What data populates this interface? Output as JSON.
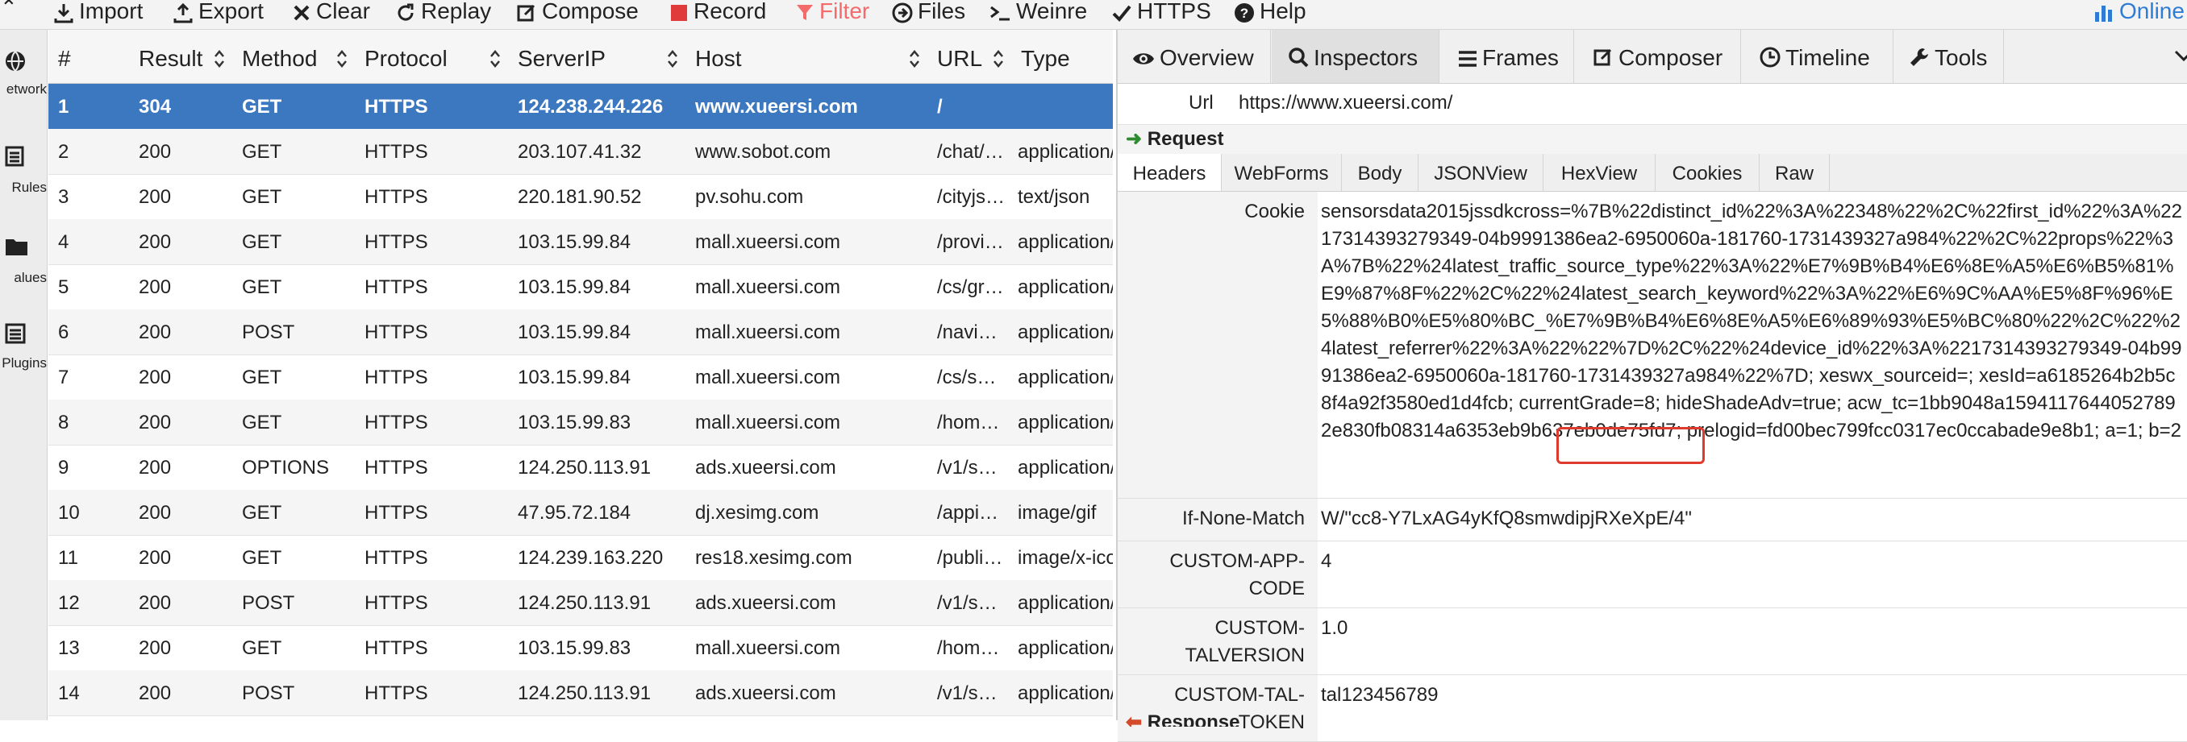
{
  "toolbar": {
    "items": [
      {
        "label": "Import",
        "icon": "import-icon"
      },
      {
        "label": "Export",
        "icon": "export-icon"
      },
      {
        "label": "Clear",
        "icon": "clear-icon"
      },
      {
        "label": "Replay",
        "icon": "replay-icon"
      },
      {
        "label": "Compose",
        "icon": "compose-icon"
      },
      {
        "label": "Record",
        "icon": "record-icon"
      },
      {
        "label": "Filter",
        "icon": "filter-icon"
      },
      {
        "label": "Files",
        "icon": "files-icon"
      },
      {
        "label": "Weinre",
        "icon": "terminal-icon"
      },
      {
        "label": "HTTPS",
        "icon": "check-icon"
      },
      {
        "label": "Help",
        "icon": "help-icon"
      }
    ],
    "online": "Online"
  },
  "sidebar": {
    "items": [
      {
        "label": "etwork",
        "icon": "network-icon"
      },
      {
        "label": "Rules",
        "icon": "rules-icon"
      },
      {
        "label": "alues",
        "icon": "values-icon"
      },
      {
        "label": "Plugins",
        "icon": "plugins-icon"
      }
    ]
  },
  "grid": {
    "columns": [
      "#",
      "Result",
      "Method",
      "Protocol",
      "ServerIP",
      "Host",
      "URL",
      "Type"
    ],
    "rows": [
      {
        "num": "1",
        "result": "304",
        "method": "GET",
        "protocol": "HTTPS",
        "ip": "124.238.244.226",
        "host": "www.xueersi.com",
        "url": "/",
        "type": ""
      },
      {
        "num": "2",
        "result": "200",
        "method": "GET",
        "protocol": "HTTPS",
        "ip": "203.107.41.32",
        "host": "www.sobot.com",
        "url": "/chat/…",
        "type": "application/"
      },
      {
        "num": "3",
        "result": "200",
        "method": "GET",
        "protocol": "HTTPS",
        "ip": "220.181.90.52",
        "host": "pv.sohu.com",
        "url": "/cityjs…",
        "type": "text/json"
      },
      {
        "num": "4",
        "result": "200",
        "method": "GET",
        "protocol": "HTTPS",
        "ip": "103.15.99.84",
        "host": "mall.xueersi.com",
        "url": "/provi…",
        "type": "application/"
      },
      {
        "num": "5",
        "result": "200",
        "method": "GET",
        "protocol": "HTTPS",
        "ip": "103.15.99.84",
        "host": "mall.xueersi.com",
        "url": "/cs/gr…",
        "type": "application/"
      },
      {
        "num": "6",
        "result": "200",
        "method": "POST",
        "protocol": "HTTPS",
        "ip": "103.15.99.84",
        "host": "mall.xueersi.com",
        "url": "/navi…",
        "type": "application/"
      },
      {
        "num": "7",
        "result": "200",
        "method": "GET",
        "protocol": "HTTPS",
        "ip": "103.15.99.84",
        "host": "mall.xueersi.com",
        "url": "/cs/s…",
        "type": "application/"
      },
      {
        "num": "8",
        "result": "200",
        "method": "GET",
        "protocol": "HTTPS",
        "ip": "103.15.99.83",
        "host": "mall.xueersi.com",
        "url": "/hom…",
        "type": "application/"
      },
      {
        "num": "9",
        "result": "200",
        "method": "OPTIONS",
        "protocol": "HTTPS",
        "ip": "124.250.113.91",
        "host": "ads.xueersi.com",
        "url": "/v1/s…",
        "type": "application/"
      },
      {
        "num": "10",
        "result": "200",
        "method": "GET",
        "protocol": "HTTPS",
        "ip": "47.95.72.184",
        "host": "dj.xesimg.com",
        "url": "/appi…",
        "type": "image/gif"
      },
      {
        "num": "11",
        "result": "200",
        "method": "GET",
        "protocol": "HTTPS",
        "ip": "124.239.163.220",
        "host": "res18.xesimg.com",
        "url": "/publi…",
        "type": "image/x-ico"
      },
      {
        "num": "12",
        "result": "200",
        "method": "POST",
        "protocol": "HTTPS",
        "ip": "124.250.113.91",
        "host": "ads.xueersi.com",
        "url": "/v1/s…",
        "type": "application/"
      },
      {
        "num": "13",
        "result": "200",
        "method": "GET",
        "protocol": "HTTPS",
        "ip": "103.15.99.83",
        "host": "mall.xueersi.com",
        "url": "/hom…",
        "type": "application/"
      },
      {
        "num": "14",
        "result": "200",
        "method": "POST",
        "protocol": "HTTPS",
        "ip": "124.250.113.91",
        "host": "ads.xueersi.com",
        "url": "/v1/s…",
        "type": "application/"
      }
    ]
  },
  "inspector": {
    "tabs": [
      {
        "label": "Overview",
        "icon": "eye-icon"
      },
      {
        "label": "Inspectors",
        "icon": "search-icon"
      },
      {
        "label": "Frames",
        "icon": "list-icon"
      },
      {
        "label": "Composer",
        "icon": "compose-icon"
      },
      {
        "label": "Timeline",
        "icon": "clock-icon"
      },
      {
        "label": "Tools",
        "icon": "wrench-icon"
      }
    ],
    "active_tab": "Inspectors",
    "url_label": "Url",
    "url_value": "https://www.xueersi.com/",
    "request_label": "Request",
    "response_label": "Response",
    "sub_tabs": [
      "Headers",
      "WebForms",
      "Body",
      "JSONView",
      "HexView",
      "Cookies",
      "Raw"
    ],
    "active_sub_tab": "Headers",
    "headers": [
      {
        "name": "Cookie",
        "value": "sensorsdata2015jssdkcross=%7B%22distinct_id%22%3A%22348%22%2C%22first_id%22%3A%2217314393279349-04b9991386ea2-6950060a-181760-1731439327a984%22%2C%22props%22%3A%7B%22%24latest_traffic_source_type%22%3A%22%E7%9B%B4%E6%8E%A5%E6%B5%81%E9%87%8F%22%2C%22%24latest_search_keyword%22%3A%22%E6%9C%AA%E5%8F%96%E5%88%B0%E5%80%BC_%E7%9B%B4%E6%8E%A5%E6%89%93%E5%BC%80%22%2C%22%24latest_referrer%22%3A%22%22%7D%2C%22%24device_id%22%3A%2217314393279349-04b9991386ea2-6950060a-181760-1731439327a984%22%7D; xeswx_sourceid=; xesId=a6185264b2b5c8f4a92f3580ed1d4fcb; currentGrade=8; hideShadeAdv=true; acw_tc=1bb9048a15941176440527892e830fb08314a6353eb9b637eb0de75fd7; prelogid=fd00bec799fcc0317ec0ccabade9e8b1; a=1; b=2"
      },
      {
        "name": "If-None-Match",
        "value": "W/\"cc8-Y7LxAG4yKfQ8smwdipjRXeXpE/4\""
      },
      {
        "name": "CUSTOM-APP-CODE",
        "value": "4"
      },
      {
        "name": "CUSTOM-TALVERSION",
        "value": "1.0"
      },
      {
        "name": "CUSTOM-TAL-TOKEN",
        "value": "tal123456789"
      }
    ]
  },
  "colors": {
    "selected_row": "#3b78c0",
    "highlight_box": "#e03a2e",
    "online": "#2f7cd6",
    "record": "#e03a3a"
  }
}
